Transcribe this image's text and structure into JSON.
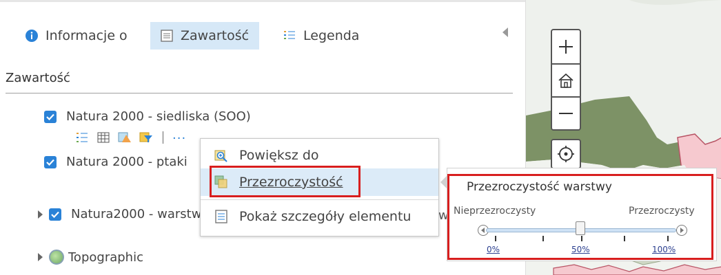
{
  "tabs": [
    {
      "label": "Informacje o",
      "icon": "info-icon"
    },
    {
      "label": "Zawartość",
      "icon": "content-list-icon",
      "active": true
    },
    {
      "label": "Legenda",
      "icon": "legend-icon"
    }
  ],
  "section": {
    "title": "Zawartość"
  },
  "layers": [
    {
      "name": "Natura 2000 - siedliska (SOO)",
      "checked": true
    },
    {
      "name": "Natura 2000 - ptaki",
      "checked": true
    },
    {
      "name": "Natura2000 - warstw",
      "checked": true
    },
    {
      "name": "Topographic"
    }
  ],
  "layer_tools": {
    "icons": [
      "legend-toggle-icon",
      "attribute-table-icon",
      "change-style-icon",
      "filter-icon"
    ],
    "more_label": "..."
  },
  "layer3_suffix": "w",
  "context_menu": {
    "items": [
      {
        "label": "Powiększ do",
        "icon": "zoom-to-icon"
      },
      {
        "label": "Przezroczystość",
        "icon": "transparency-icon",
        "highlighted": true
      },
      {
        "label": "Pokaż szczegóły elementu",
        "icon": "details-icon"
      }
    ]
  },
  "transparency_panel": {
    "title": "Przezroczystość warstwy",
    "left_label": "Nieprzezroczysty",
    "right_label": "Przezroczysty",
    "value_percent": 50,
    "tick_labels": [
      "0%",
      "50%",
      "100%"
    ]
  },
  "map_controls": [
    "zoom-in-icon",
    "home-icon",
    "zoom-out-icon",
    "locate-icon"
  ],
  "colors": {
    "accent": "#2a82d7",
    "highlight": "#d81e1e",
    "active_tab": "#d6e8f7",
    "map_green": "#7d9266",
    "map_pink": "#f6c9cf"
  }
}
